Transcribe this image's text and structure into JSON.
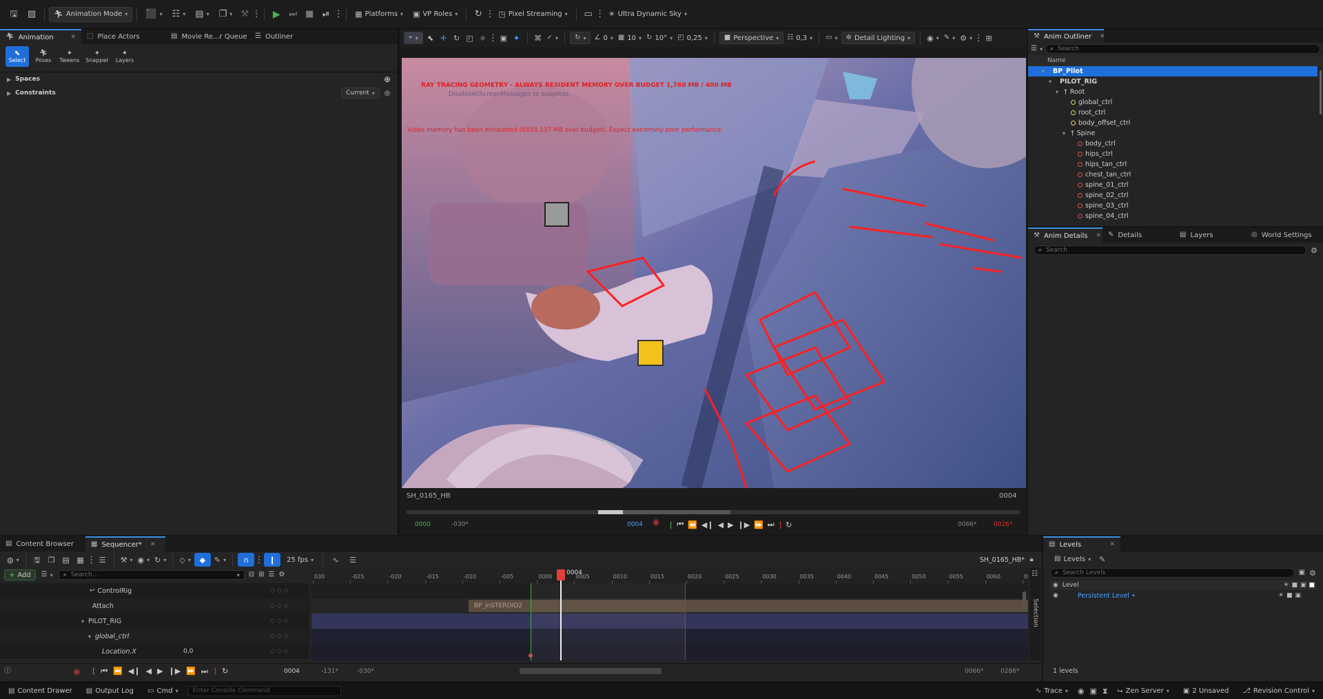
{
  "toolbar": {
    "mode": "Animation Mode",
    "platforms": "Platforms",
    "vp_roles": "VP Roles",
    "pixel_streaming": "Pixel Streaming",
    "sky": "Ultra Dynamic Sky"
  },
  "left_tabs": [
    {
      "label": "Animation"
    },
    {
      "label": "Place Actors"
    },
    {
      "label": "Movie Re...r Queue"
    },
    {
      "label": "Outliner"
    }
  ],
  "anim_tools": [
    {
      "label": "Select",
      "icon": "select-icon"
    },
    {
      "label": "Poses",
      "icon": "poses-icon"
    },
    {
      "label": "Tweens",
      "icon": "tweens-icon"
    },
    {
      "label": "Snapper",
      "icon": "snapper-icon"
    },
    {
      "label": "Layers",
      "icon": "layers-icon"
    }
  ],
  "spaces_label": "Spaces",
  "constraints_label": "Constraints",
  "constraints_dropdown": "Current",
  "viewport": {
    "perspective": "Perspective",
    "lighting": "Detail Lighting",
    "snap_grid": "10",
    "snap_rot": "10°",
    "snap_scale": "0,25",
    "cam_speed": "0,3",
    "angle": "0",
    "warn1": "RAY TRACING GEOMETRY - ALWAYS RESIDENT MEMORY OVER BUDGET 1,760 MB / 400 MB",
    "warn1_sub": "DisableAllScreenMessages to suppress",
    "warn2": "Video memory has been exhausted (6533.137 MB over budget). Expect extremely poor performance.",
    "shot_name": "SH_0165_HB",
    "frame_label": "0004",
    "pb_start": "0000",
    "pb_in": "-030*",
    "pb_current": "0004",
    "pb_out": "0066*",
    "pb_end": "0026*"
  },
  "anim_outliner": {
    "title": "Anim Outliner",
    "search_placeholder": "Search",
    "col_name": "Name",
    "items": [
      {
        "label": "BP_Pilot",
        "indent": 1,
        "icon": "actor",
        "selected": true
      },
      {
        "label": "PILOT_RIG",
        "indent": 2,
        "icon": "none",
        "selected": false
      },
      {
        "label": "Root",
        "indent": 3,
        "icon": "root",
        "selected": false
      },
      {
        "label": "global_ctrl",
        "indent": 4,
        "icon": "yellow",
        "selected": false
      },
      {
        "label": "root_ctrl",
        "indent": 4,
        "icon": "yellow",
        "selected": false
      },
      {
        "label": "body_offset_ctrl",
        "indent": 4,
        "icon": "yellow",
        "selected": false
      },
      {
        "label": "Spine",
        "indent": 4,
        "icon": "spine",
        "selected": false
      },
      {
        "label": "body_ctrl",
        "indent": 5,
        "icon": "red",
        "selected": false
      },
      {
        "label": "hips_ctrl",
        "indent": 5,
        "icon": "red",
        "selected": false
      },
      {
        "label": "hips_tan_ctrl",
        "indent": 5,
        "icon": "red",
        "selected": false
      },
      {
        "label": "chest_tan_ctrl",
        "indent": 5,
        "icon": "red",
        "selected": false
      },
      {
        "label": "spine_01_ctrl",
        "indent": 5,
        "icon": "red",
        "selected": false
      },
      {
        "label": "spine_02_ctrl",
        "indent": 5,
        "icon": "red",
        "selected": false
      },
      {
        "label": "spine_03_ctrl",
        "indent": 5,
        "icon": "red",
        "selected": false
      },
      {
        "label": "spine_04_ctrl",
        "indent": 5,
        "icon": "red",
        "selected": false
      }
    ]
  },
  "details_tabs": [
    {
      "label": "Anim Details"
    },
    {
      "label": "Details"
    },
    {
      "label": "Layers"
    },
    {
      "label": "World Settings"
    }
  ],
  "details_search": "Search",
  "bottom_tabs": [
    {
      "label": "Content Browser"
    },
    {
      "label": "Sequencer*"
    }
  ],
  "sequencer": {
    "fps": "25 fps",
    "sequence_name": "SH_0165_HB*",
    "add_label": "Add",
    "search_placeholder": "Search...",
    "current_frame": "0004",
    "ticks": [
      "030",
      "-025",
      "-020",
      "-015",
      "-010",
      "-005",
      "0000",
      "0005",
      "0010",
      "0015",
      "0020",
      "0025",
      "0030",
      "0035",
      "0040",
      "0045",
      "0050",
      "0055",
      "0060",
      "006"
    ],
    "tracks": [
      {
        "label": "ControlRig",
        "italic": false
      },
      {
        "label": "Attach",
        "italic": false
      },
      {
        "label": "PILOT_RIG",
        "italic": false
      },
      {
        "label": "global_ctrl",
        "italic": true
      },
      {
        "label": "Location.X",
        "italic": true
      }
    ],
    "location_x_value": "0,0",
    "attach_section": "BP_inSTEROID2",
    "frame_field": "0004",
    "range_a": "-131*",
    "range_b": "-030*",
    "range_c": "0066*",
    "range_d": "0286*"
  },
  "levels": {
    "title": "Levels",
    "dropdown": "Levels",
    "search_placeholder": "Search Levels",
    "col_level": "Level",
    "persistent": "Persistent Level •",
    "count": "1 levels",
    "selection_label": "Selection"
  },
  "statusbar": {
    "content_drawer": "Content Drawer",
    "output_log": "Output Log",
    "cmd": "Cmd",
    "console_placeholder": "Enter Console Command",
    "trace": "Trace",
    "zen": "Zen Server",
    "unsaved": "2 Unsaved",
    "revision": "Revision Control"
  }
}
